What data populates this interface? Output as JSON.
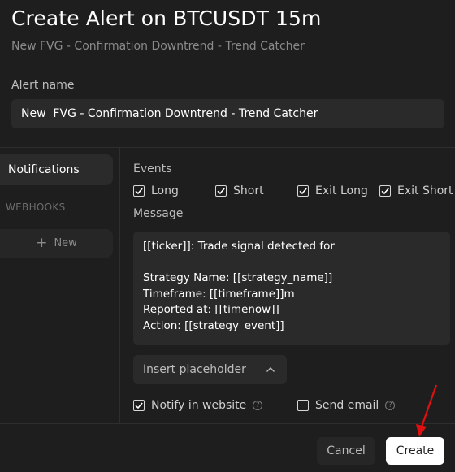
{
  "header": {
    "title": "Create Alert on BTCUSDT 15m",
    "subtitle": "New FVG - Confirmation Downtrend - Trend Catcher"
  },
  "alert_name": {
    "label": "Alert name",
    "value": "New  FVG - Confirmation Downtrend - Trend Catcher"
  },
  "sidebar": {
    "notifications_label": "Notifications",
    "webhooks_label": "WEBHOOKS",
    "new_label": "New"
  },
  "events": {
    "label": "Events",
    "items": [
      {
        "label": "Long",
        "checked": true
      },
      {
        "label": "Short",
        "checked": true
      },
      {
        "label": "Exit Long",
        "checked": true
      },
      {
        "label": "Exit Short",
        "checked": true
      }
    ]
  },
  "message": {
    "label": "Message",
    "text": "[[ticker]]: Trade signal detected for\n\nStrategy Name: [[strategy_name]]\nTimeframe: [[timeframe]]m\nReported at: [[timenow]]\nAction: [[strategy_event]]"
  },
  "insert_placeholder": {
    "label": "Insert placeholder"
  },
  "options": {
    "notify_website": {
      "label": "Notify in website",
      "checked": true
    },
    "send_email": {
      "label": "Send email",
      "checked": false
    }
  },
  "footer": {
    "cancel_label": "Cancel",
    "create_label": "Create"
  },
  "colors": {
    "background": "#1e1e1e",
    "input_bg": "#2a2a2a",
    "primary_button": "#ffffff",
    "annotation_arrow": "#e01010"
  },
  "icons": {
    "check": "check-icon",
    "plus": "plus-icon",
    "chevron": "chevron-up-icon",
    "help": "help-circle-icon",
    "arrow": "red-arrow-icon"
  }
}
